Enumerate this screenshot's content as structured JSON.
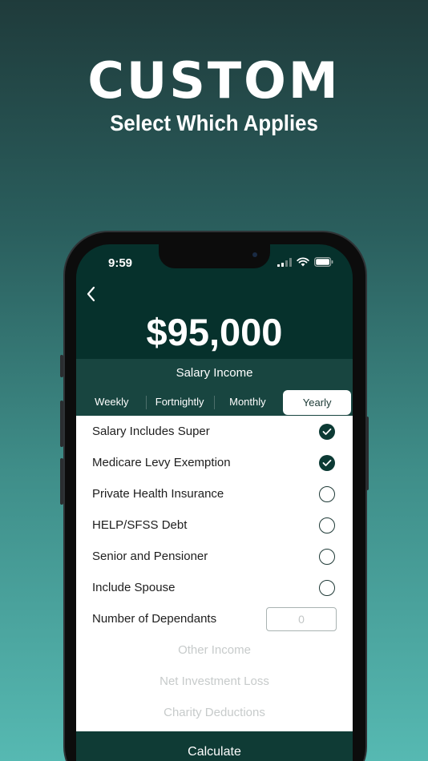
{
  "promo": {
    "headline": "CUSTOM",
    "subheadline": "Select Which Applies"
  },
  "status_bar": {
    "time": "9:59",
    "icons": [
      "cellular-signal-icon",
      "wifi-icon",
      "battery-icon"
    ]
  },
  "header": {
    "amount": "$95,000",
    "income_type": "Salary Income"
  },
  "tabs": [
    {
      "label": "Weekly",
      "active": false
    },
    {
      "label": "Fortnightly",
      "active": false
    },
    {
      "label": "Monthly",
      "active": false
    },
    {
      "label": "Yearly",
      "active": true
    }
  ],
  "options": [
    {
      "label": "Salary Includes Super",
      "checked": true
    },
    {
      "label": "Medicare Levy Exemption",
      "checked": true
    },
    {
      "label": "Private Health Insurance",
      "checked": false
    },
    {
      "label": "HELP/SFSS Debt",
      "checked": false
    },
    {
      "label": "Senior and Pensioner",
      "checked": false
    },
    {
      "label": "Include Spouse",
      "checked": false
    }
  ],
  "dependants": {
    "label": "Number of Dependants",
    "placeholder": "0"
  },
  "extras": [
    "Other Income",
    "Net Investment Loss",
    "Charity Deductions"
  ],
  "actions": {
    "calculate_label": "Calculate"
  },
  "colors": {
    "primary": "#06312c",
    "bar": "#184540",
    "check": "#0c3a34"
  }
}
